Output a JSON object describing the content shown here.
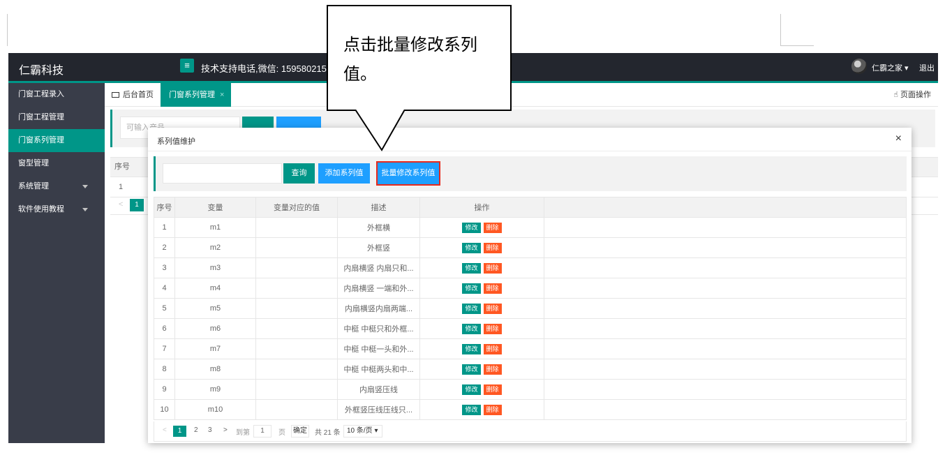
{
  "app": {
    "logo": "仁霸科技",
    "menu_icon": "≡",
    "support": "技术支持电话,微信: 15958021543",
    "user": "仁霸之家 ▾",
    "logout": "退出"
  },
  "sidebar": {
    "items": [
      {
        "label": "门窗工程录入",
        "active": false
      },
      {
        "label": "门窗工程管理",
        "active": false
      },
      {
        "label": "门窗系列管理",
        "active": true
      },
      {
        "label": "窗型管理",
        "active": false
      },
      {
        "label": "系统管理",
        "active": false,
        "has_children": true
      },
      {
        "label": "软件使用教程",
        "active": false,
        "has_children": true
      }
    ]
  },
  "tabs": {
    "home": "后台首页",
    "series": "门窗系列管理",
    "close": "×",
    "page_ops": "页面操作"
  },
  "background": {
    "input_placeholder": "可输入产品",
    "seq_header": "序号",
    "row1": "1",
    "prev": "<",
    "page1": "1"
  },
  "modal": {
    "title": "系列值维护",
    "close": "×",
    "search_value": "",
    "query_label": "查询",
    "add_label": "添加系列值",
    "batch_label": "批量修改系列值",
    "columns": [
      "序号",
      "变量",
      "变量对应的值",
      "描述",
      "操作"
    ],
    "edit_label": "修改",
    "delete_label": "删除",
    "rows": [
      {
        "seq": "1",
        "var": "m1",
        "value": "",
        "desc": "外框横"
      },
      {
        "seq": "2",
        "var": "m2",
        "value": "",
        "desc": "外框竖"
      },
      {
        "seq": "3",
        "var": "m3",
        "value": "",
        "desc": "内扇横竖 内扇只和..."
      },
      {
        "seq": "4",
        "var": "m4",
        "value": "",
        "desc": "内扇横竖 一端和外..."
      },
      {
        "seq": "5",
        "var": "m5",
        "value": "",
        "desc": "内扇横竖内扇两端..."
      },
      {
        "seq": "6",
        "var": "m6",
        "value": "",
        "desc": "中梃 中梃只和外框..."
      },
      {
        "seq": "7",
        "var": "m7",
        "value": "",
        "desc": "中梃 中梃一头和外..."
      },
      {
        "seq": "8",
        "var": "m8",
        "value": "",
        "desc": "中梃 中梃两头和中..."
      },
      {
        "seq": "9",
        "var": "m9",
        "value": "",
        "desc": "内扇竖压线"
      },
      {
        "seq": "10",
        "var": "m10",
        "value": "",
        "desc": "外框竖压线压线只..."
      }
    ],
    "pager": {
      "prev": "<",
      "pages": [
        "1",
        "2",
        "3"
      ],
      "next": ">",
      "goto_label": "到第",
      "goto_value": "1",
      "page_unit": "页",
      "confirm": "确定",
      "total": "共 21 条",
      "per_page": "10 条/页 ▾"
    }
  },
  "callout": {
    "text": "点击批量修改系列值。"
  }
}
